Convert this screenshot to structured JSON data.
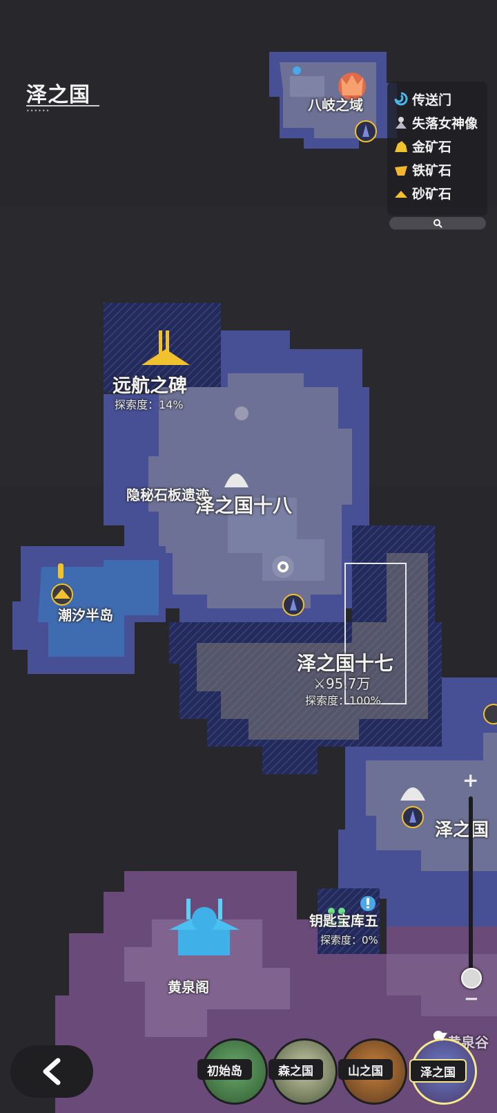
{
  "region_title": "泽之国",
  "legend": {
    "items": [
      {
        "label": "传送门",
        "icon": "teleport-icon"
      },
      {
        "label": "失落女神像",
        "icon": "goddess-statue-icon"
      },
      {
        "label": "金矿石",
        "icon": "gold-ore-icon"
      },
      {
        "label": "铁矿石",
        "icon": "iron-ore-icon"
      },
      {
        "label": "砂矿石",
        "icon": "sand-ore-icon"
      }
    ],
    "search_icon": "search-icon"
  },
  "map_labels": {
    "yamata": "八岐之域",
    "voyage_monument": "远航之碑",
    "voyage_exploration": "探索度：14%",
    "hidden_ruins": "隐秘石板遗迹",
    "zone18": "泽之国十八",
    "tidal_peninsula": "潮汐半岛",
    "zone17": "泽之国十七",
    "zone17_value": "95.7万",
    "zone17_exploration": "探索度：100%",
    "zone_right": "泽之国",
    "key_vault": "钥匙宝库五",
    "key_vault_exploration": "探索度：0%",
    "yellow_spring_pavilion": "黄泉阁",
    "yellow_spring_valley": "黄泉谷"
  },
  "tabs": [
    {
      "label": "初始岛",
      "active": false
    },
    {
      "label": "森之国",
      "active": false
    },
    {
      "label": "山之国",
      "active": false
    },
    {
      "label": "泽之国",
      "active": true
    }
  ],
  "colors": {
    "background": "#2a2a2e",
    "region_blue_light": "#6d7196",
    "region_blue_mid": "#474f95",
    "region_blue_dark": "#1f2a66",
    "region_purple": "#6a4a79",
    "gold": "#f2c12e",
    "active_tab_border": "#f5e98a"
  }
}
